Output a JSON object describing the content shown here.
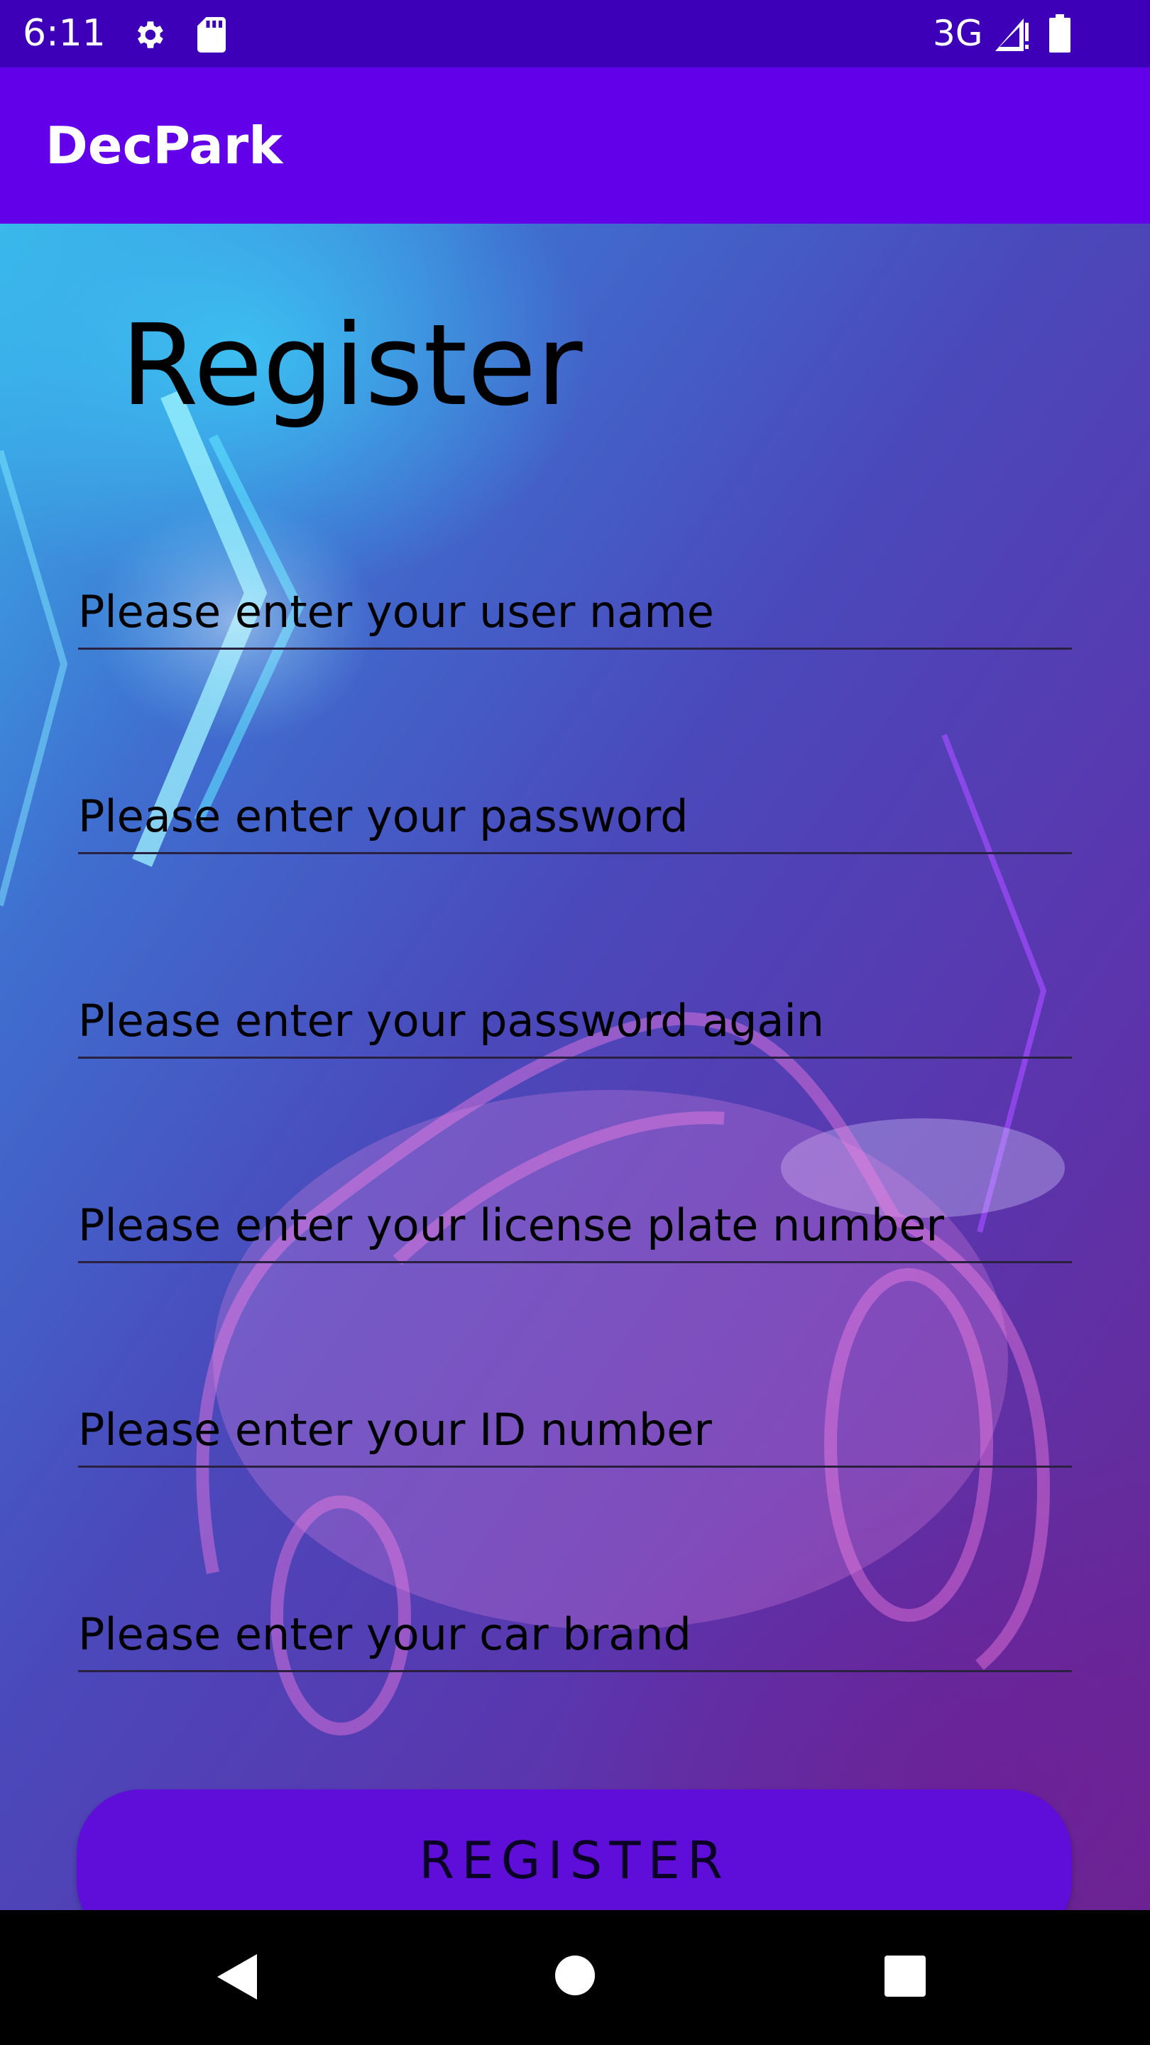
{
  "status_bar": {
    "time": "6:11",
    "network": "3G",
    "icons": [
      "gear-icon",
      "sd-card-icon",
      "signal-icon",
      "battery-icon"
    ]
  },
  "app_bar": {
    "title": "DecPark"
  },
  "form": {
    "heading": "Register",
    "fields": [
      {
        "name": "username",
        "placeholder": "Please enter your user name",
        "value": ""
      },
      {
        "name": "password",
        "placeholder": "Please enter your password",
        "value": ""
      },
      {
        "name": "password-again",
        "placeholder": "Please enter your password again",
        "value": ""
      },
      {
        "name": "license-plate",
        "placeholder": "Please enter your license plate number",
        "value": ""
      },
      {
        "name": "id-number",
        "placeholder": "Please enter your ID number",
        "value": ""
      },
      {
        "name": "car-brand",
        "placeholder": "Please enter your car brand",
        "value": ""
      }
    ],
    "submit_label": "REGISTER"
  },
  "nav_bar": {
    "icons": [
      "back-icon",
      "home-icon",
      "recents-icon"
    ]
  },
  "colors": {
    "status_bar": "#3d00b8",
    "app_bar": "#6200ea",
    "button": "#5e0ed8"
  }
}
